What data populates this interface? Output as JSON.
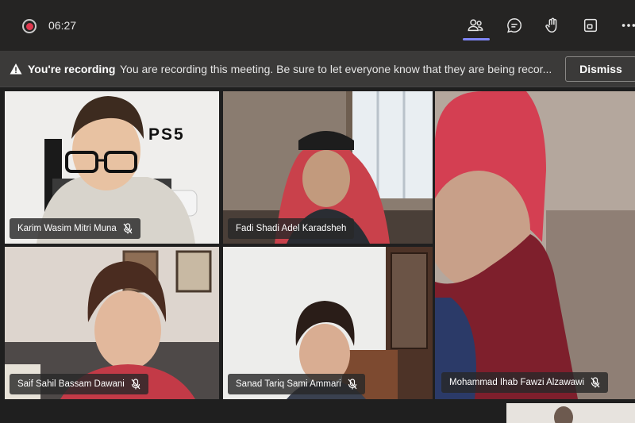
{
  "meeting": {
    "timer": "06:27"
  },
  "banner": {
    "title": "You're recording",
    "message": "You are recording this meeting. Be sure to let everyone know that they are being recor...",
    "dismiss_label": "Dismiss"
  },
  "participants": [
    {
      "name": "Karim Wasim Mitri Muna",
      "muted": true
    },
    {
      "name": "Fadi Shadi Adel Karadsheh",
      "muted": false
    },
    {
      "name": "Mohammad Ihab Fawzi Alzawawi",
      "muted": true
    },
    {
      "name": "Saif Sahil Bassam Dawani",
      "muted": true
    },
    {
      "name": "Sanad Tariq Sami Ammari",
      "muted": true
    }
  ],
  "background_text": {
    "ps5_logo": "PS5"
  },
  "colors": {
    "accent": "#7f85f5",
    "record": "#e0384f"
  }
}
